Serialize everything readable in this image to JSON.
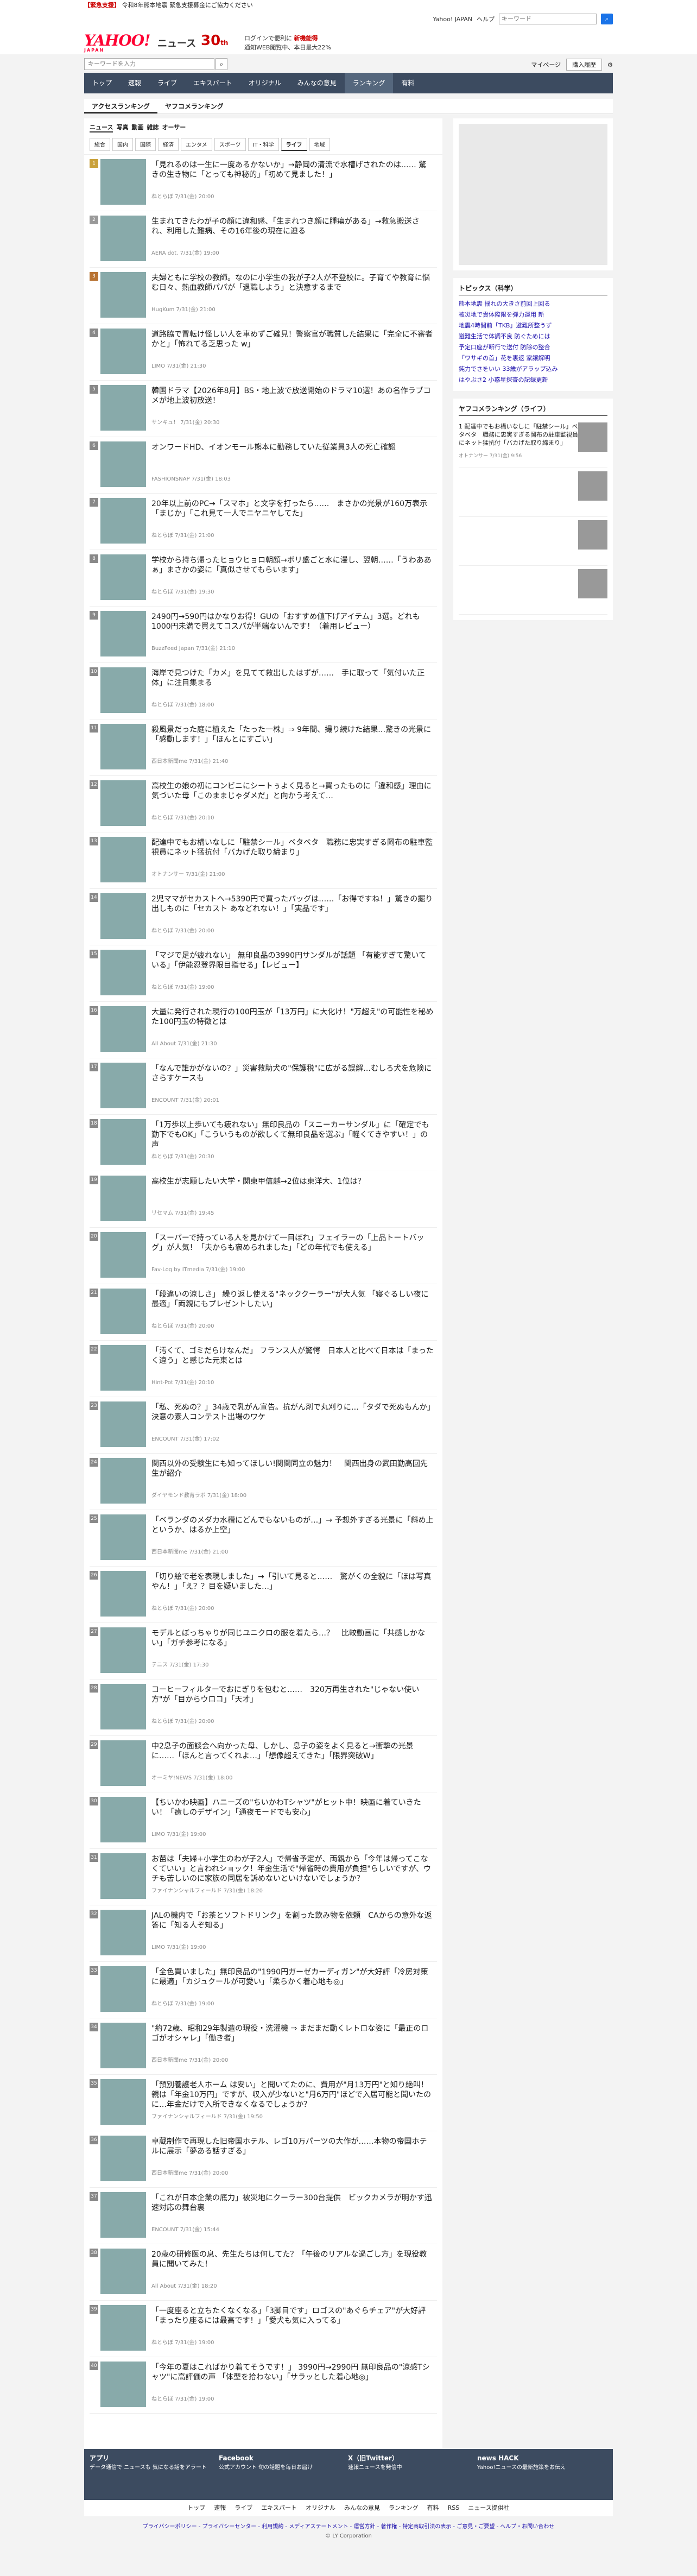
{
  "alert": {
    "tag": "【緊急支援】",
    "text": "令和8年熊本地震 緊急支援募金にご協力ください"
  },
  "logo": {
    "main": "YAHOO!",
    "sub": "JAPAN",
    "section": "ニュース"
  },
  "anniversary": {
    "num": "30",
    "unit": "th"
  },
  "promo": {
    "line1": "ログインで便利に",
    "bold1": "新機能得",
    "line2": "通知WEB閲覧中、本日最大22%"
  },
  "top_links": {
    "yahoo": "Yahoo! JAPAN",
    "help": "ヘルプ",
    "keyword_placeholder": "キーワード"
  },
  "search": {
    "placeholder": "キーワードを入力",
    "mypage": "マイページ",
    "buy": "購入履歴"
  },
  "gnav": [
    "トップ",
    "速報",
    "ライブ",
    "エキスパート",
    "オリジナル",
    "みんなの意見",
    "ランキング",
    "有料"
  ],
  "tabs1": [
    "アクセスランキング",
    "ヤフコメランキング"
  ],
  "tabs2": [
    "ニュース",
    "写真",
    "動画",
    "雑誌",
    "オーサー"
  ],
  "tabs3": [
    "総合",
    "国内",
    "国際",
    "経済",
    "エンタメ",
    "スポーツ",
    "IT・科学",
    "ライフ",
    "地域"
  ],
  "items": [
    {
      "rank": "1",
      "title": "「見れるのは一生に一度あるかないか」→静岡の清流で水槽げされたのは…… 驚きの生き物に「とっても神秘的」「初めて見ました！」",
      "meta": "ねとらぼ 7/31(金) 20:00"
    },
    {
      "rank": "2",
      "title": "生まれてきたわが子の顔に違和感、「生まれつき顔に腫瘍がある」→救急搬送され、利用した難病、その16年後の現在に迫る",
      "meta": "AERA dot. 7/31(金) 19:00"
    },
    {
      "rank": "3",
      "title": "夫婦ともに学校の教師。なのに小学生の我が子2人が不登校に。子育てや教育に悩む日々、熱血教師パパが「退職しよう」と決意するまで",
      "meta": "HugKum 7/31(金) 21:00"
    },
    {
      "rank": "4",
      "title": "道路脇で冒転け怪しい人を車めずご確見！警察官が職質した結果に「完全に不審者かと」「怖れてる乏思った w」",
      "meta": "LIMO 7/31(金) 21:30"
    },
    {
      "rank": "5",
      "title": "韓国ドラマ【2026年8月】BS・地上波で放送開始のドラマ10選！あの名作ラブコメが地上波初放送！",
      "meta": "サンキュ！ 7/31(金) 20:30"
    },
    {
      "rank": "6",
      "title": "オンワードHD、イオンモール熊本に勤務していた従業員3人の死亡確認",
      "meta": "FASHIONSNAP 7/31(金) 18:03"
    },
    {
      "rank": "7",
      "title": "20年以上前のPC→「スマホ」と文字を打ったら……　まさかの光景が160万表示「まじか」「これ見て一人でニヤニヤしてた」",
      "meta": "ねとらぼ 7/31(金) 21:00"
    },
    {
      "rank": "8",
      "title": "学校から持ち帰ったヒョウヒョロ朝顔→ボリ盛ごと水に漫し、翌朝……「うわああぁ」まさかの姿に「真似させてもらいます」",
      "meta": "ねとらぼ 7/31(金) 19:30"
    },
    {
      "rank": "9",
      "title": "2490円→590円はかなりお得！GUの「おすすめ値下げアイテム」3選。どれも1000円未満で買えてコスパが半端ないんです！（着用レビュー）",
      "meta": "BuzzFeed Japan 7/31(金) 21:10"
    },
    {
      "rank": "10",
      "title": "海岸で見つけた「カメ」を見てて救出したはずが……　手に取って「気付いた正体」に注目集まる",
      "meta": "ねとらぼ 7/31(金) 18:00"
    },
    {
      "rank": "11",
      "title": "殺風景だった庭に植えた「たった一株」⇒ 9年間、撮り続けた結果…驚きの光景に「感動します！」「ほんとにすごい」",
      "meta": "西日本新聞me 7/31(金) 21:40"
    },
    {
      "rank": "12",
      "title": "高校生の娘の初にコンビニにシートぅよく見ると→買ったものに「違和感」理由に気づいた母「このままじゃダメだ」と向かう考えて…",
      "meta": "ねとらぼ 7/31(金) 20:10"
    },
    {
      "rank": "13",
      "title": "配達中でもお構いなしに「駐禁シール」ベタベタ　職務に忠実すぎる岡布の駐車監視員にネット猛抗付「バカげた取り締まり」",
      "meta": "オトナンサー 7/31(金) 21:00"
    },
    {
      "rank": "14",
      "title": "2児ママがセカストへ→5390円で買ったバッグは……「お得ですね！」驚きの掘り出しものに「セカスト あなどれない！」「実品です」",
      "meta": "ねとらぼ 7/31(金) 20:00"
    },
    {
      "rank": "15",
      "title": "「マジで足が疲れない」 無印良品の3990円サンダルが話題 「有能すぎて驚いている」「伊能忍登界限目指せる」【レビュー】",
      "meta": "ねとらぼ 7/31(金) 19:00"
    },
    {
      "rank": "16",
      "title": "大量に発行された現行の100円玉が「13万円」に大化け！\"万超え\"の可能性を秘めた100円玉の特徴とは",
      "meta": "All About 7/31(金) 21:30"
    },
    {
      "rank": "17",
      "title": "「なんで誰かがないの？」災害救助犬の\"保護税\"に広がる誤解…むしろ犬を危険にさらすケースも",
      "meta": "ENCOUNT 7/31(金) 20:01"
    },
    {
      "rank": "18",
      "title": "「1万歩以上歩いても疲れない」無印良品の「スニーカーサンダル」に「確定でも勤下でもOK」「こういうものが欲しくて無印良品を選ぶ」「軽くてきやすい！」の声",
      "meta": "ねとらぼ 7/31(金) 20:30"
    },
    {
      "rank": "19",
      "title": "高校生が志願したい大学・関東甲信越→2位は東洋大、1位は？",
      "meta": "リセマム 7/31(金) 19:45"
    },
    {
      "rank": "20",
      "title": "「スーパーで持っている人を見かけて一目ぼれ」フェイラーの「上品トートバッグ」が人気！「夫からも褒められました」「どの年代でも使える」",
      "meta": "Fav-Log by ITmedia 7/31(金) 19:00"
    },
    {
      "rank": "21",
      "title": "「段違いの涼しさ」 繰り返し使える\"ネッククーラー\"が大人気 「寝ぐるしい夜に最適」「両親にもプレゼントしたい」",
      "meta": "ねとらぼ 7/31(金) 20:00"
    },
    {
      "rank": "22",
      "title": "「汚くて、ゴミだらけなんだ」 フランス人が驚愕　日本人と比べて日本は「まったく違う」と感じた元東とは",
      "meta": "Hint-Pot 7/31(金) 20:10"
    },
    {
      "rank": "23",
      "title": "「私、死ぬの？」34歳で乳がん宣告。抗がん剤で丸刈りに…「タダで死ぬもんか」決意の素人コンテスト出場のワケ",
      "meta": "ENCOUNT 7/31(金) 17:02"
    },
    {
      "rank": "24",
      "title": "関西以外の受験生にも知ってほしい!関関同立の魅力！　関西出身の武田勤高回先生が紹介",
      "meta": "ダイヤモンド教育ラボ 7/31(金) 18:00"
    },
    {
      "rank": "25",
      "title": "「ベランダのメダカ水槽にどんでもないものが…」→ 予想外すぎる光景に「斜め上というか、はるか上空」",
      "meta": "西日本新聞me 7/31(金) 21:00"
    },
    {
      "rank": "26",
      "title": "「切り絵で⽼を表現しました」→「引いて見ると……　驚がくの全貌に「ほは写真やん！」「え？？目を疑いました…」",
      "meta": "ねとらぼ 7/31(金) 20:00"
    },
    {
      "rank": "27",
      "title": "モデルとぼっちゃりが同じユニクロの服を着たら…？　比較動画に「共感しかない」「ガチ参考になる」",
      "meta": "テニス 7/31(金) 17:30"
    },
    {
      "rank": "28",
      "title": "コーヒーフィルターでおにぎりを包むと……　320万再生された\"じゃない使い方\"が「目からウロコ」「天才」",
      "meta": "ねとらぼ 7/31(金) 20:00"
    },
    {
      "rank": "29",
      "title": "中2息子の面談会へ向かった母、しかし、息子の姿をよく見ると→衝撃の光景に……「ほんと言ってくれよ…」「想像超えてきた」「限界突破W」",
      "meta": "オーミヤ!NEWS 7/31(金) 18:00"
    },
    {
      "rank": "30",
      "title": "【ちいかわ映画】ハニーズの\"ちいかわTシャツ\"がヒット中！映画に着ていきたい！「癒しのデザイン」「通夜モードでも安心」",
      "meta": "LIMO 7/31(金) 19:00"
    },
    {
      "rank": "31",
      "title": "お苗は「夫婦+小学生のわが子2人」で帰省予定が、両親から「今年は帰ってこなくていい」と言われショック！年金生活で\"帰省時の費用が負担\"らしいですが、ウチも苦しいのに家族の同居を訴めないといけないでしょうか？",
      "meta": "ファイナンシャルフィールド 7/31(金) 18:20"
    },
    {
      "rank": "32",
      "title": "JALの機内で「お茶とソフトドリンク」を割った飲み物を依頼　CAからの意外な返答に「知る人ぞ知る」",
      "meta": "LIMO 7/31(金) 19:00"
    },
    {
      "rank": "33",
      "title": "「全色買いました」無印良品の\"1990円ガーゼカーディガン\"が大好評「冷房対策に最適」「カジュクールが可愛い」「柔らかく着心地も◎」",
      "meta": "ねとらぼ 7/31(金) 19:00"
    },
    {
      "rank": "34",
      "title": "\"約72歳、昭和29年製造の現役・洗濯機 ⇒ まだまだ動くレトロな姿に「最正のロゴがオシャレ」「働き者」",
      "meta": "西日本新聞me 7/31(金) 20:00"
    },
    {
      "rank": "35",
      "title": "「預別養護老人ホーム は安い」と聞いてたのに、費用が\"月13万円\"と知り絶叫！親は「年金10万円」ですが、収入が少ないと\"月6万円\"ほどで入居可能と聞いたのに…年金だけで入所できなくなるでしょうか？",
      "meta": "ファイナンシャルフィールド 7/31(金) 19:50"
    },
    {
      "rank": "36",
      "title": "卓蔵制作で再現した旧帝国ホテル、レゴ10万パーツの大作が……本物の帝国ホテルに展示「夢ある話すぎる」",
      "meta": "西日本新聞me 7/31(金) 20:00"
    },
    {
      "rank": "37",
      "title": "「これが日本企業の底力」被災地にクーラー300台提供　ビックカメラが明かす迅速対応の舞台裏",
      "meta": "ENCOUNT 7/31(金) 15:44"
    },
    {
      "rank": "38",
      "title": "20歳の研修医の息、先生たちは何してた？「午後のリアルな過ごし方」を現役教員に聞いてみた！",
      "meta": "All About 7/31(金) 18:20"
    },
    {
      "rank": "39",
      "title": "「一度座ると立ちたくなくなる」「3脚目です」ロゴスの\"あぐらチェア\"が大好評「まったり座るには最高です！」「愛犬も気に入ってる」",
      "meta": "ねとらぼ 7/31(金) 19:00"
    },
    {
      "rank": "40",
      "title": "「今年の夏はこればかり着てそうです！」 3990円→2990円 無印良品の\"涼感Tシャツ\"に高評価の声 「体型を拾わない」「サラッとした着心地◎」",
      "meta": "ねとらぼ 7/31(金) 19:00"
    }
  ],
  "side": {
    "topics_title": "トピックス（科学）",
    "topics": [
      "熊本地震 揺れの大きさ前回上回る",
      "被災地で貴体際限を弾力運用 新",
      "地震4時間前「TKB」避難所整うず",
      "避難生活で体調不良 防ぐためには",
      "予定口座が断行で送付 防除の整合",
      "「ワサギの首」花を裏返 家譲解明",
      "鈍力でさをいい 33歳がアラップ込み",
      "はやぶさ2 小惑星探査の記録更新"
    ],
    "comment_title": "ヤフコメランキング（ライフ）",
    "comment_items": [
      {
        "rank": "1",
        "title": "配達中でもお構いなしに「駐禁シール」ベタベタ　職務に忠実すぎる岡布の駐車監視員にネット猛抗付「バカげた取り締まり」",
        "meta": "オトナンサー 7/31(金) 9:56"
      }
    ]
  },
  "footer": {
    "apps": [
      {
        "name": "アプリ",
        "desc": "データ通信で ニュースも 気になる話をアラート"
      },
      {
        "name": "Facebook",
        "desc": "公式アカウント 旬の話題を毎日お届け"
      },
      {
        "name": "X（旧Twitter）",
        "desc": "速報ニュースを発信中"
      },
      {
        "name": "news HACK",
        "desc": "Yahoo!ニュースの最新施策をお伝え"
      }
    ],
    "nav": [
      "トップ",
      "速報",
      "ライブ",
      "エキスパート",
      "オリジナル",
      "みんなの意見",
      "ランキング",
      "有料",
      "RSS",
      "ニュース提供社"
    ],
    "links": "プライバシーポリシー - プライバシーセンター - 利用規約 - メディアステートメント - 運営方針 - 著作権 - 特定商取引法の表示 - ご意見・ご要望 - ヘルプ・お問い合わせ",
    "copyright": "© LY Corporation"
  }
}
